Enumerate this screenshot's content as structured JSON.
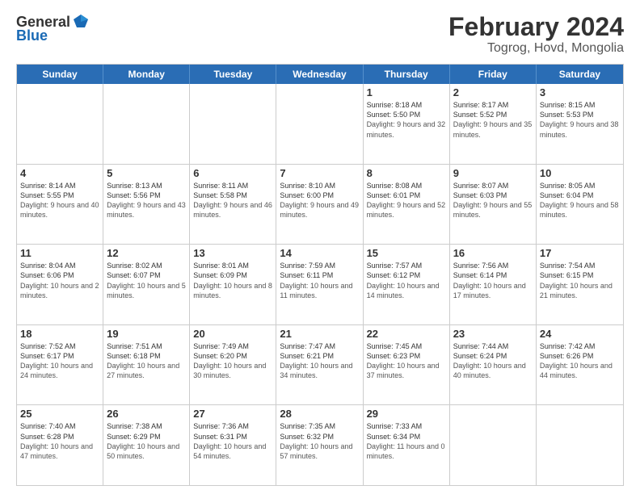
{
  "header": {
    "logo_general": "General",
    "logo_blue": "Blue",
    "title": "February 2024",
    "subtitle": "Togrog, Hovd, Mongolia"
  },
  "weekdays": [
    "Sunday",
    "Monday",
    "Tuesday",
    "Wednesday",
    "Thursday",
    "Friday",
    "Saturday"
  ],
  "rows": [
    [
      {
        "date": "",
        "info": ""
      },
      {
        "date": "",
        "info": ""
      },
      {
        "date": "",
        "info": ""
      },
      {
        "date": "",
        "info": ""
      },
      {
        "date": "1",
        "sunrise": "8:18 AM",
        "sunset": "5:50 PM",
        "daylight": "9 hours and 32 minutes."
      },
      {
        "date": "2",
        "sunrise": "8:17 AM",
        "sunset": "5:52 PM",
        "daylight": "9 hours and 35 minutes."
      },
      {
        "date": "3",
        "sunrise": "8:15 AM",
        "sunset": "5:53 PM",
        "daylight": "9 hours and 38 minutes."
      }
    ],
    [
      {
        "date": "4",
        "sunrise": "8:14 AM",
        "sunset": "5:55 PM",
        "daylight": "9 hours and 40 minutes."
      },
      {
        "date": "5",
        "sunrise": "8:13 AM",
        "sunset": "5:56 PM",
        "daylight": "9 hours and 43 minutes."
      },
      {
        "date": "6",
        "sunrise": "8:11 AM",
        "sunset": "5:58 PM",
        "daylight": "9 hours and 46 minutes."
      },
      {
        "date": "7",
        "sunrise": "8:10 AM",
        "sunset": "6:00 PM",
        "daylight": "9 hours and 49 minutes."
      },
      {
        "date": "8",
        "sunrise": "8:08 AM",
        "sunset": "6:01 PM",
        "daylight": "9 hours and 52 minutes."
      },
      {
        "date": "9",
        "sunrise": "8:07 AM",
        "sunset": "6:03 PM",
        "daylight": "9 hours and 55 minutes."
      },
      {
        "date": "10",
        "sunrise": "8:05 AM",
        "sunset": "6:04 PM",
        "daylight": "9 hours and 58 minutes."
      }
    ],
    [
      {
        "date": "11",
        "sunrise": "8:04 AM",
        "sunset": "6:06 PM",
        "daylight": "10 hours and 2 minutes."
      },
      {
        "date": "12",
        "sunrise": "8:02 AM",
        "sunset": "6:07 PM",
        "daylight": "10 hours and 5 minutes."
      },
      {
        "date": "13",
        "sunrise": "8:01 AM",
        "sunset": "6:09 PM",
        "daylight": "10 hours and 8 minutes."
      },
      {
        "date": "14",
        "sunrise": "7:59 AM",
        "sunset": "6:11 PM",
        "daylight": "10 hours and 11 minutes."
      },
      {
        "date": "15",
        "sunrise": "7:57 AM",
        "sunset": "6:12 PM",
        "daylight": "10 hours and 14 minutes."
      },
      {
        "date": "16",
        "sunrise": "7:56 AM",
        "sunset": "6:14 PM",
        "daylight": "10 hours and 17 minutes."
      },
      {
        "date": "17",
        "sunrise": "7:54 AM",
        "sunset": "6:15 PM",
        "daylight": "10 hours and 21 minutes."
      }
    ],
    [
      {
        "date": "18",
        "sunrise": "7:52 AM",
        "sunset": "6:17 PM",
        "daylight": "10 hours and 24 minutes."
      },
      {
        "date": "19",
        "sunrise": "7:51 AM",
        "sunset": "6:18 PM",
        "daylight": "10 hours and 27 minutes."
      },
      {
        "date": "20",
        "sunrise": "7:49 AM",
        "sunset": "6:20 PM",
        "daylight": "10 hours and 30 minutes."
      },
      {
        "date": "21",
        "sunrise": "7:47 AM",
        "sunset": "6:21 PM",
        "daylight": "10 hours and 34 minutes."
      },
      {
        "date": "22",
        "sunrise": "7:45 AM",
        "sunset": "6:23 PM",
        "daylight": "10 hours and 37 minutes."
      },
      {
        "date": "23",
        "sunrise": "7:44 AM",
        "sunset": "6:24 PM",
        "daylight": "10 hours and 40 minutes."
      },
      {
        "date": "24",
        "sunrise": "7:42 AM",
        "sunset": "6:26 PM",
        "daylight": "10 hours and 44 minutes."
      }
    ],
    [
      {
        "date": "25",
        "sunrise": "7:40 AM",
        "sunset": "6:28 PM",
        "daylight": "10 hours and 47 minutes."
      },
      {
        "date": "26",
        "sunrise": "7:38 AM",
        "sunset": "6:29 PM",
        "daylight": "10 hours and 50 minutes."
      },
      {
        "date": "27",
        "sunrise": "7:36 AM",
        "sunset": "6:31 PM",
        "daylight": "10 hours and 54 minutes."
      },
      {
        "date": "28",
        "sunrise": "7:35 AM",
        "sunset": "6:32 PM",
        "daylight": "10 hours and 57 minutes."
      },
      {
        "date": "29",
        "sunrise": "7:33 AM",
        "sunset": "6:34 PM",
        "daylight": "11 hours and 0 minutes."
      },
      {
        "date": "",
        "info": ""
      },
      {
        "date": "",
        "info": ""
      }
    ]
  ]
}
